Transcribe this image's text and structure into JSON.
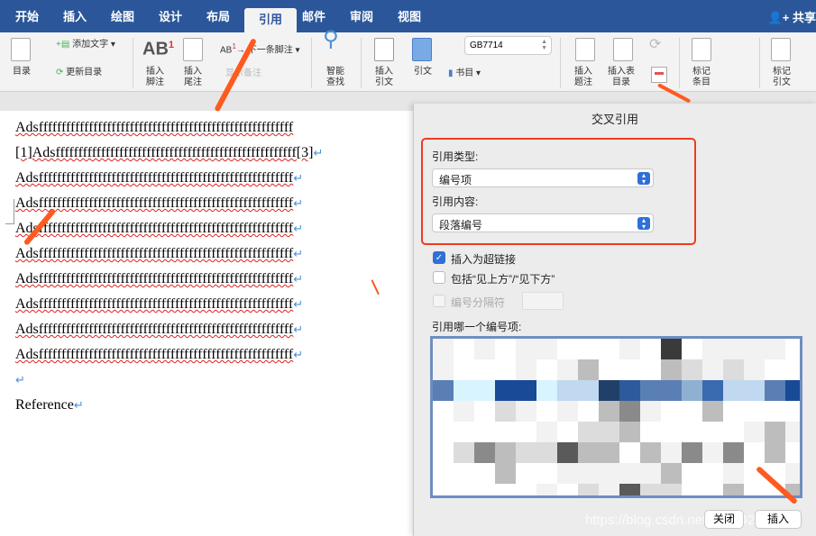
{
  "tabs": [
    "开始",
    "插入",
    "绘图",
    "设计",
    "布局",
    "引用",
    "邮件",
    "审阅",
    "视图"
  ],
  "active_tab": "引用",
  "share": "共享",
  "ribbon": {
    "toc": "目录",
    "add_text": "添加文字",
    "update_toc": "更新目录",
    "insert_footnote": [
      "插入",
      "脚注"
    ],
    "insert_endnote": [
      "插入",
      "尾注"
    ],
    "next_footnote": "下一条脚注",
    "show_notes": "显示备注",
    "smart_lookup": [
      "智能",
      "查找"
    ],
    "insert_citation": [
      "插入",
      "引文"
    ],
    "citations": "引文",
    "style": "GB7714",
    "bibliography": "书目",
    "insert_caption": [
      "插入",
      "题注"
    ],
    "insert_tof": [
      "插入表",
      "目录"
    ],
    "mark_entry": [
      "标记",
      "条目"
    ],
    "mark_citation": [
      "标记",
      "引文"
    ]
  },
  "document": {
    "lines": [
      "Adsffffffffffffffffffffffffffffffffffffffffffffffffffffffff",
      "[1]Adsfffffffffffffffffffffffffffffffffffffffffffffffffffff[3]",
      "Adsffffffffffffffffffffffffffffffffffffffffffffffffffffffff",
      "Adsffffffffffffffffffffffffffffffffffffffffffffffffffffffff",
      "Adsffffffffffffffffffffffffffffffffffffffffffffffffffffffff",
      "Adsffffffffffffffffffffffffffffffffffffffffffffffffffffffff",
      "Adsffffffffffffffffffffffffffffffffffffffffffffffffffffffff",
      "Adsffffffffffffffffffffffffffffffffffffffffffffffffffffffff",
      "Adsffffffffffffffffffffffffffffffffffffffffffffffffffffffff",
      "Adsffffffffffffffffffffffffffffffffffffffffffffffffffffffff",
      "",
      "Reference"
    ],
    "para_mark": "↵"
  },
  "dialog": {
    "title": "交叉引用",
    "ref_type_label": "引用类型:",
    "ref_type_value": "编号项",
    "ref_content_label": "引用内容:",
    "ref_content_value": "段落编号",
    "hyperlink": {
      "label": "插入为超链接",
      "checked": true
    },
    "above_below": {
      "label": "包括“见上方”/“见下方”",
      "checked": false
    },
    "separator": {
      "label": "编号分隔符",
      "checked": false,
      "enabled": false
    },
    "which_label": "引用哪一个编号项:",
    "close": "关闭",
    "insert": "插入"
  },
  "watermark": "https://blog.csdn.net/u0144212129",
  "colors": {
    "brand": "#2b579a",
    "highlight": "#f03b20",
    "arrow": "#ff5a1f",
    "accent": "#2f6fd6"
  }
}
